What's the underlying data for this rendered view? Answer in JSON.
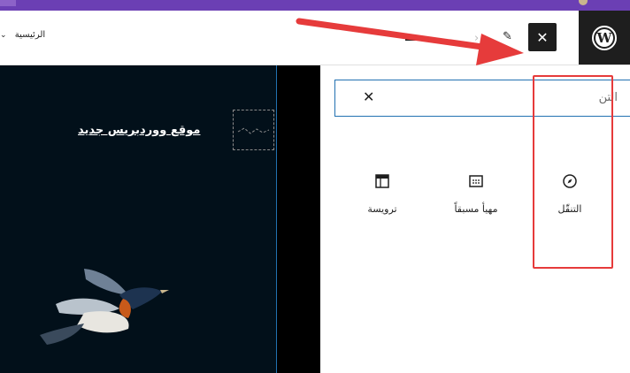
{
  "toolbar": {
    "page_label": "الرئيسية",
    "close_label": "✕"
  },
  "inserter": {
    "search_value": "التن",
    "clear_label": "✕",
    "blocks": [
      {
        "label": "التنقّل",
        "icon": "compass-icon"
      },
      {
        "label": "مهيأ مسبقاً",
        "icon": "template-part-icon"
      },
      {
        "label": "ترويسة",
        "icon": "header-icon"
      }
    ]
  },
  "canvas": {
    "site_title": "موقع ووردبريس جديد"
  },
  "colors": {
    "accent": "#2271b1",
    "annotation_red": "#e63b3b",
    "admin_bar": "#6b3fb4",
    "dark": "#1e1e1e"
  }
}
